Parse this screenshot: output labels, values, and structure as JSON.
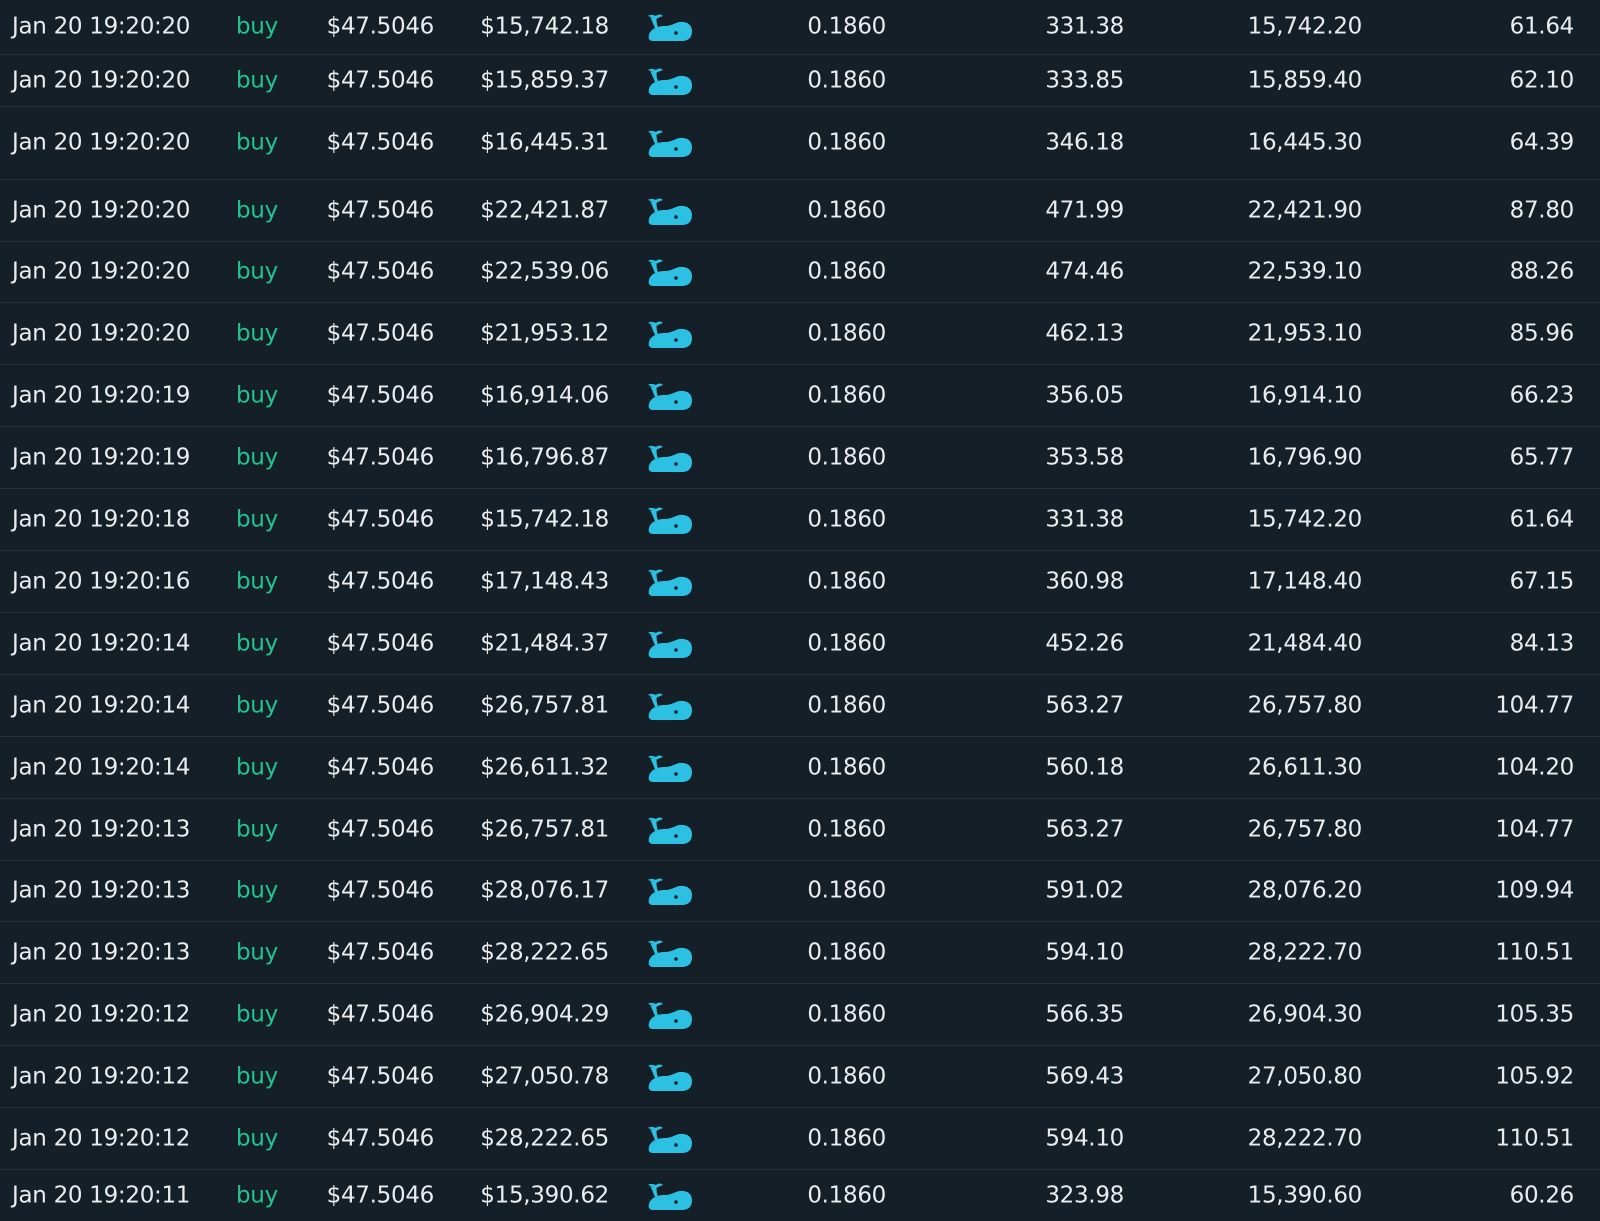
{
  "colors": {
    "background": "#141f27",
    "text": "#e9edf0",
    "buy": "#22c38e",
    "whale_icon": "#2cc0e2",
    "divider": "#24323c"
  },
  "icons": {
    "size_badge": "whale-icon"
  },
  "rows": [
    {
      "time": "Jan 20 19:20:20",
      "side": "buy",
      "price": "$47.5046",
      "total": "$15,742.18",
      "fee": "0.1860",
      "amount": "331.38",
      "volume": "15,742.20",
      "last": "61.64"
    },
    {
      "time": "Jan 20 19:20:20",
      "side": "buy",
      "price": "$47.5046",
      "total": "$15,859.37",
      "fee": "0.1860",
      "amount": "333.85",
      "volume": "15,859.40",
      "last": "62.10"
    },
    {
      "time": "Jan 20 19:20:20",
      "side": "buy",
      "price": "$47.5046",
      "total": "$16,445.31",
      "fee": "0.1860",
      "amount": "346.18",
      "volume": "16,445.30",
      "last": "64.39"
    },
    {
      "time": "Jan 20 19:20:20",
      "side": "buy",
      "price": "$47.5046",
      "total": "$22,421.87",
      "fee": "0.1860",
      "amount": "471.99",
      "volume": "22,421.90",
      "last": "87.80"
    },
    {
      "time": "Jan 20 19:20:20",
      "side": "buy",
      "price": "$47.5046",
      "total": "$22,539.06",
      "fee": "0.1860",
      "amount": "474.46",
      "volume": "22,539.10",
      "last": "88.26"
    },
    {
      "time": "Jan 20 19:20:20",
      "side": "buy",
      "price": "$47.5046",
      "total": "$21,953.12",
      "fee": "0.1860",
      "amount": "462.13",
      "volume": "21,953.10",
      "last": "85.96"
    },
    {
      "time": "Jan 20 19:20:19",
      "side": "buy",
      "price": "$47.5046",
      "total": "$16,914.06",
      "fee": "0.1860",
      "amount": "356.05",
      "volume": "16,914.10",
      "last": "66.23"
    },
    {
      "time": "Jan 20 19:20:19",
      "side": "buy",
      "price": "$47.5046",
      "total": "$16,796.87",
      "fee": "0.1860",
      "amount": "353.58",
      "volume": "16,796.90",
      "last": "65.77"
    },
    {
      "time": "Jan 20 19:20:18",
      "side": "buy",
      "price": "$47.5046",
      "total": "$15,742.18",
      "fee": "0.1860",
      "amount": "331.38",
      "volume": "15,742.20",
      "last": "61.64"
    },
    {
      "time": "Jan 20 19:20:16",
      "side": "buy",
      "price": "$47.5046",
      "total": "$17,148.43",
      "fee": "0.1860",
      "amount": "360.98",
      "volume": "17,148.40",
      "last": "67.15"
    },
    {
      "time": "Jan 20 19:20:14",
      "side": "buy",
      "price": "$47.5046",
      "total": "$21,484.37",
      "fee": "0.1860",
      "amount": "452.26",
      "volume": "21,484.40",
      "last": "84.13"
    },
    {
      "time": "Jan 20 19:20:14",
      "side": "buy",
      "price": "$47.5046",
      "total": "$26,757.81",
      "fee": "0.1860",
      "amount": "563.27",
      "volume": "26,757.80",
      "last": "104.77"
    },
    {
      "time": "Jan 20 19:20:14",
      "side": "buy",
      "price": "$47.5046",
      "total": "$26,611.32",
      "fee": "0.1860",
      "amount": "560.18",
      "volume": "26,611.30",
      "last": "104.20"
    },
    {
      "time": "Jan 20 19:20:13",
      "side": "buy",
      "price": "$47.5046",
      "total": "$26,757.81",
      "fee": "0.1860",
      "amount": "563.27",
      "volume": "26,757.80",
      "last": "104.77"
    },
    {
      "time": "Jan 20 19:20:13",
      "side": "buy",
      "price": "$47.5046",
      "total": "$28,076.17",
      "fee": "0.1860",
      "amount": "591.02",
      "volume": "28,076.20",
      "last": "109.94"
    },
    {
      "time": "Jan 20 19:20:13",
      "side": "buy",
      "price": "$47.5046",
      "total": "$28,222.65",
      "fee": "0.1860",
      "amount": "594.10",
      "volume": "28,222.70",
      "last": "110.51"
    },
    {
      "time": "Jan 20 19:20:12",
      "side": "buy",
      "price": "$47.5046",
      "total": "$26,904.29",
      "fee": "0.1860",
      "amount": "566.35",
      "volume": "26,904.30",
      "last": "105.35"
    },
    {
      "time": "Jan 20 19:20:12",
      "side": "buy",
      "price": "$47.5046",
      "total": "$27,050.78",
      "fee": "0.1860",
      "amount": "569.43",
      "volume": "27,050.80",
      "last": "105.92"
    },
    {
      "time": "Jan 20 19:20:12",
      "side": "buy",
      "price": "$47.5046",
      "total": "$28,222.65",
      "fee": "0.1860",
      "amount": "594.10",
      "volume": "28,222.70",
      "last": "110.51"
    },
    {
      "time": "Jan 20 19:20:11",
      "side": "buy",
      "price": "$47.5046",
      "total": "$15,390.62",
      "fee": "0.1860",
      "amount": "323.98",
      "volume": "15,390.60",
      "last": "60.26"
    }
  ]
}
